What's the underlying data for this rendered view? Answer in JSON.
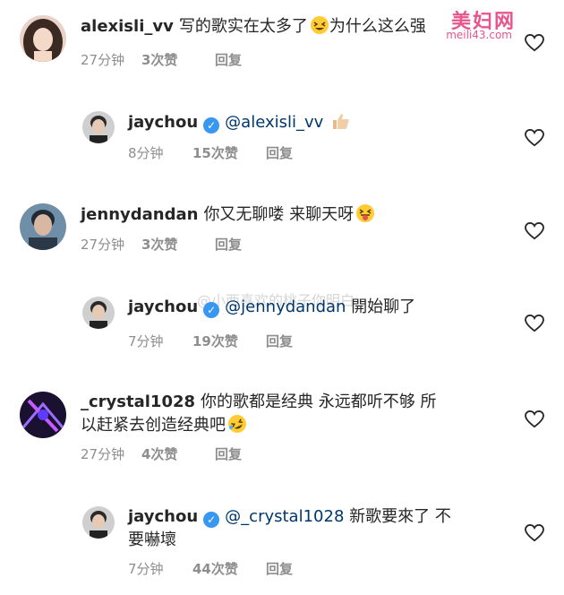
{
  "watermarks": {
    "site_name": "美妇网",
    "site_url": "meili43.com",
    "weibo": "@小西喜欢的桃子你明白"
  },
  "comments": [
    {
      "username": "alexisli_vv",
      "verified": false,
      "mention": "",
      "text": "写的歌实在太多了",
      "text_after_emoji": "为什么这么强",
      "emoji": "grinning-squint-emoji",
      "time": "27分钟",
      "likes": "3次赞",
      "reply_label": "回复"
    },
    {
      "username": "jaychou",
      "verified": true,
      "mention": "@alexisli_vv",
      "text": "",
      "emoji": "thumbs-up-emoji",
      "time": "8分钟",
      "likes": "15次赞",
      "reply_label": "回复"
    },
    {
      "username": "jennydandan",
      "verified": false,
      "mention": "",
      "text": "你又无聊喽 来聊天呀",
      "emoji": "tongue-out-emoji",
      "time": "27分钟",
      "likes": "3次赞",
      "reply_label": "回复"
    },
    {
      "username": "jaychou",
      "verified": true,
      "mention": "@jennydandan",
      "text": "開始聊了",
      "emoji": "",
      "time": "7分钟",
      "likes": "19次赞",
      "reply_label": "回复"
    },
    {
      "username": "_crystal1028",
      "verified": false,
      "mention": "",
      "text": "你的歌都是经典 永远都听不够 所",
      "text_line2": "以赶紧去创造经典吧",
      "emoji": "rofl-emoji",
      "time": "27分钟",
      "likes": "4次赞",
      "reply_label": "回复"
    },
    {
      "username": "jaychou",
      "verified": true,
      "mention": "@_crystal1028",
      "text": "新歌要來了 不",
      "text_line2": "要嚇壞",
      "emoji": "",
      "time": "7分钟",
      "likes": "44次赞",
      "reply_label": "回复"
    }
  ]
}
